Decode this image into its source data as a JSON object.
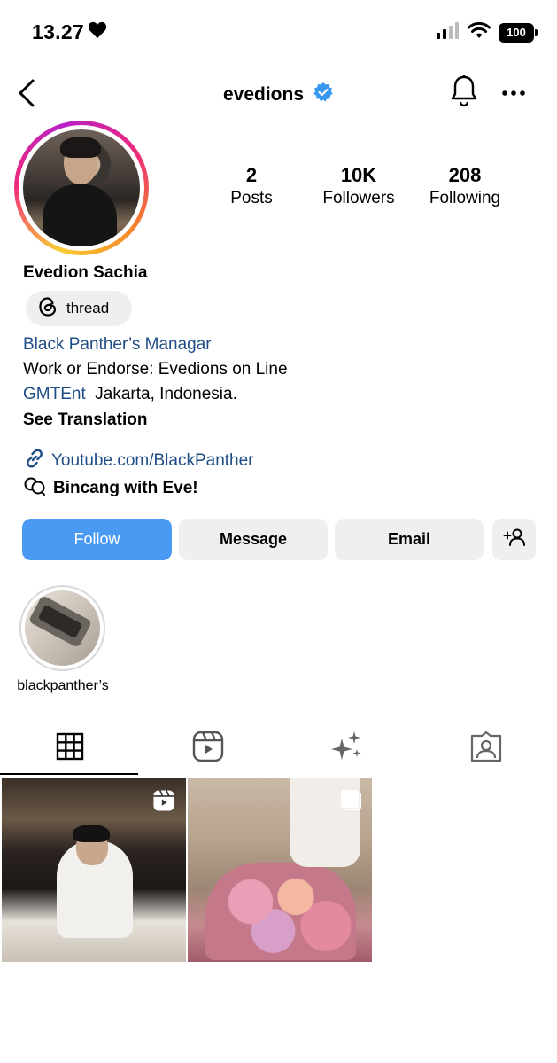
{
  "status": {
    "time": "13.27",
    "battery": "100"
  },
  "header": {
    "username": "evedions"
  },
  "profile": {
    "stats": [
      {
        "value": "2",
        "label": "Posts"
      },
      {
        "value": "10K",
        "label": "Followers"
      },
      {
        "value": "208",
        "label": "Following"
      }
    ],
    "full_name": "Evedion Sachia",
    "threads_label": "thread",
    "bio": {
      "line1": "Black Panther’s Managar",
      "line2": "Work or Endorse: Evedions on Line",
      "line3_link": "GMTEnt",
      "line3_text": "Jakarta, Indonesia.",
      "see_translation": "See Translation"
    },
    "website": "Youtube.com/BlackPanther",
    "channel": "Bincang with Eve!"
  },
  "actions": {
    "follow": "Follow",
    "message": "Message",
    "email": "Email"
  },
  "highlights": [
    {
      "label": "blackpanther’s"
    }
  ],
  "tabs": [
    {
      "icon": "grid-icon",
      "active": true
    },
    {
      "icon": "reels-icon",
      "active": false
    },
    {
      "icon": "sparkles-icon",
      "active": false
    },
    {
      "icon": "tagged-icon",
      "active": false
    }
  ],
  "colors": {
    "follow": "#4a9af3",
    "link": "#1e4d86",
    "verified": "#3897f0"
  }
}
